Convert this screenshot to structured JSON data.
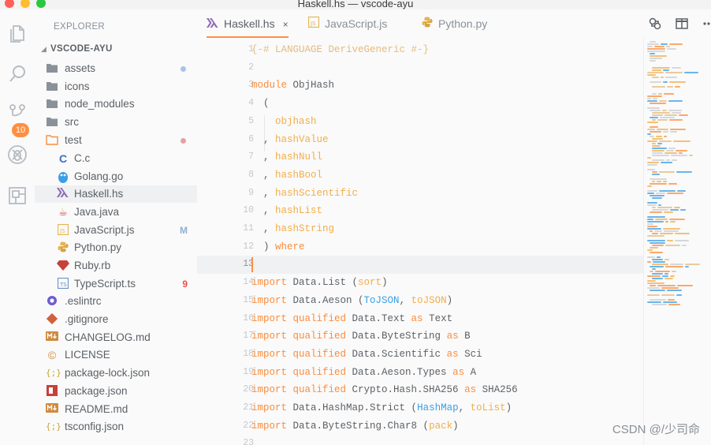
{
  "window": {
    "title": "Haskell.hs — vscode-ayu"
  },
  "activity_bar": {
    "items": [
      {
        "name": "explorer",
        "icon": "files-icon"
      },
      {
        "name": "search",
        "icon": "search-icon"
      },
      {
        "name": "source-control",
        "icon": "source-control-icon",
        "badge": "10"
      },
      {
        "name": "debug",
        "icon": "debug-icon"
      },
      {
        "name": "extensions",
        "icon": "extensions-icon"
      }
    ]
  },
  "sidebar": {
    "title": "EXPLORER",
    "root_folder": "VSCODE-AYU",
    "items": [
      {
        "label": "assets",
        "type": "folder",
        "decoration": "dot",
        "decoration_color": "#a8c4e6"
      },
      {
        "label": "icons",
        "type": "folder"
      },
      {
        "label": "node_modules",
        "type": "folder"
      },
      {
        "label": "src",
        "type": "folder"
      },
      {
        "label": "test",
        "type": "folder-open",
        "decoration": "dot",
        "decoration_color": "#e6a0a0"
      },
      {
        "label": "C.c",
        "type": "file",
        "icon": "c-icon",
        "indent": 1
      },
      {
        "label": "Golang.go",
        "type": "file",
        "icon": "go-icon",
        "indent": 1
      },
      {
        "label": "Haskell.hs",
        "type": "file",
        "icon": "haskell-icon",
        "indent": 1,
        "active": true
      },
      {
        "label": "Java.java",
        "type": "file",
        "icon": "java-icon",
        "indent": 1
      },
      {
        "label": "JavaScript.js",
        "type": "file",
        "icon": "javascript-icon",
        "indent": 1,
        "decoration": "M",
        "decoration_color": "#8fb0d6"
      },
      {
        "label": "Python.py",
        "type": "file",
        "icon": "python-icon",
        "indent": 1
      },
      {
        "label": "Ruby.rb",
        "type": "file",
        "icon": "ruby-icon",
        "indent": 1
      },
      {
        "label": "TypeScript.ts",
        "type": "file",
        "icon": "typescript-icon",
        "indent": 1,
        "decoration": "9",
        "decoration_color": "#e65050"
      },
      {
        "label": ".eslintrc",
        "type": "file",
        "icon": "eslint-icon"
      },
      {
        "label": ".gitignore",
        "type": "file",
        "icon": "git-icon"
      },
      {
        "label": "CHANGELOG.md",
        "type": "file",
        "icon": "markdown-icon"
      },
      {
        "label": "LICENSE",
        "type": "file",
        "icon": "license-icon"
      },
      {
        "label": "package-lock.json",
        "type": "file",
        "icon": "json-icon"
      },
      {
        "label": "package.json",
        "type": "file",
        "icon": "npm-icon"
      },
      {
        "label": "README.md",
        "type": "file",
        "icon": "markdown-icon"
      },
      {
        "label": "tsconfig.json",
        "type": "file",
        "icon": "json-icon"
      }
    ]
  },
  "tabs": [
    {
      "label": "Haskell.hs",
      "icon": "haskell-icon",
      "active": true,
      "close": "×"
    },
    {
      "label": "JavaScript.js",
      "icon": "javascript-icon",
      "active": false
    },
    {
      "label": "Python.py",
      "icon": "python-icon",
      "active": false
    }
  ],
  "tab_actions": [
    {
      "name": "open-changes",
      "icon": "compare-icon"
    },
    {
      "name": "split-editor",
      "icon": "split-editor-icon"
    }
  ],
  "editor": {
    "current_line": 13,
    "lines": [
      {
        "n": "1",
        "tokens": [
          [
            "pragma",
            "{-# LANGUAGE DeriveGeneric #-}"
          ]
        ]
      },
      {
        "n": "2",
        "tokens": []
      },
      {
        "n": "3",
        "tokens": [
          [
            "kw",
            "module "
          ],
          [
            "mod",
            "ObjHash"
          ]
        ]
      },
      {
        "n": "4",
        "tokens": [
          [
            "punc",
            "  ("
          ]
        ]
      },
      {
        "n": "5",
        "tokens": [
          [
            "punc",
            "    "
          ],
          [
            "fn",
            "objhash"
          ]
        ]
      },
      {
        "n": "6",
        "tokens": [
          [
            "punc",
            "  , "
          ],
          [
            "fn",
            "hashValue"
          ]
        ]
      },
      {
        "n": "7",
        "tokens": [
          [
            "punc",
            "  , "
          ],
          [
            "fn",
            "hashNull"
          ]
        ]
      },
      {
        "n": "8",
        "tokens": [
          [
            "punc",
            "  , "
          ],
          [
            "fn",
            "hashBool"
          ]
        ]
      },
      {
        "n": "9",
        "tokens": [
          [
            "punc",
            "  , "
          ],
          [
            "fn",
            "hashScientific"
          ]
        ]
      },
      {
        "n": "10",
        "tokens": [
          [
            "punc",
            "  , "
          ],
          [
            "fn",
            "hashList"
          ]
        ]
      },
      {
        "n": "11",
        "tokens": [
          [
            "punc",
            "  , "
          ],
          [
            "fn",
            "hashString"
          ]
        ]
      },
      {
        "n": "12",
        "tokens": [
          [
            "punc",
            "  ) "
          ],
          [
            "kw",
            "where"
          ]
        ]
      },
      {
        "n": "13",
        "tokens": []
      },
      {
        "n": "14",
        "tokens": [
          [
            "kw",
            "import "
          ],
          [
            "mod",
            "Data.List "
          ],
          [
            "punc",
            "("
          ],
          [
            "fn",
            "sort"
          ],
          [
            "punc",
            ")"
          ]
        ]
      },
      {
        "n": "15",
        "tokens": [
          [
            "kw",
            "import "
          ],
          [
            "mod",
            "Data.Aeson "
          ],
          [
            "punc",
            "("
          ],
          [
            "type",
            "ToJSON"
          ],
          [
            "punc",
            ", "
          ],
          [
            "fn",
            "toJSON"
          ],
          [
            "punc",
            ")"
          ]
        ]
      },
      {
        "n": "16",
        "tokens": [
          [
            "kw",
            "import "
          ],
          [
            "kw",
            "qualified "
          ],
          [
            "mod",
            "Data.Text "
          ],
          [
            "kw",
            "as "
          ],
          [
            "mod",
            "Text"
          ]
        ]
      },
      {
        "n": "17",
        "tokens": [
          [
            "kw",
            "import "
          ],
          [
            "kw",
            "qualified "
          ],
          [
            "mod",
            "Data.ByteString "
          ],
          [
            "kw",
            "as "
          ],
          [
            "mod",
            "B"
          ]
        ]
      },
      {
        "n": "18",
        "tokens": [
          [
            "kw",
            "import "
          ],
          [
            "kw",
            "qualified "
          ],
          [
            "mod",
            "Data.Scientific "
          ],
          [
            "kw",
            "as "
          ],
          [
            "mod",
            "Sci"
          ]
        ]
      },
      {
        "n": "19",
        "tokens": [
          [
            "kw",
            "import "
          ],
          [
            "kw",
            "qualified "
          ],
          [
            "mod",
            "Data.Aeson.Types "
          ],
          [
            "kw",
            "as "
          ],
          [
            "mod",
            "A"
          ]
        ]
      },
      {
        "n": "20",
        "tokens": [
          [
            "kw",
            "import "
          ],
          [
            "kw",
            "qualified "
          ],
          [
            "mod",
            "Crypto.Hash.SHA256 "
          ],
          [
            "kw",
            "as "
          ],
          [
            "mod",
            "SHA256"
          ]
        ]
      },
      {
        "n": "21",
        "tokens": [
          [
            "kw",
            "import "
          ],
          [
            "mod",
            "Data.HashMap.Strict "
          ],
          [
            "punc",
            "("
          ],
          [
            "type",
            "HashMap"
          ],
          [
            "punc",
            ", "
          ],
          [
            "fn",
            "toList"
          ],
          [
            "punc",
            ")"
          ]
        ]
      },
      {
        "n": "22",
        "tokens": [
          [
            "kw",
            "import "
          ],
          [
            "mod",
            "Data.ByteString.Char8 "
          ],
          [
            "punc",
            "("
          ],
          [
            "fn",
            "pack"
          ],
          [
            "punc",
            ")"
          ]
        ]
      },
      {
        "n": "23",
        "tokens": []
      }
    ]
  },
  "watermark": "CSDN @/少司命",
  "colors": {
    "accent": "#ff8f40",
    "keyword": "#fa8d3e",
    "function": "#f2ae49",
    "type": "#399ee6",
    "text": "#5c6166"
  }
}
